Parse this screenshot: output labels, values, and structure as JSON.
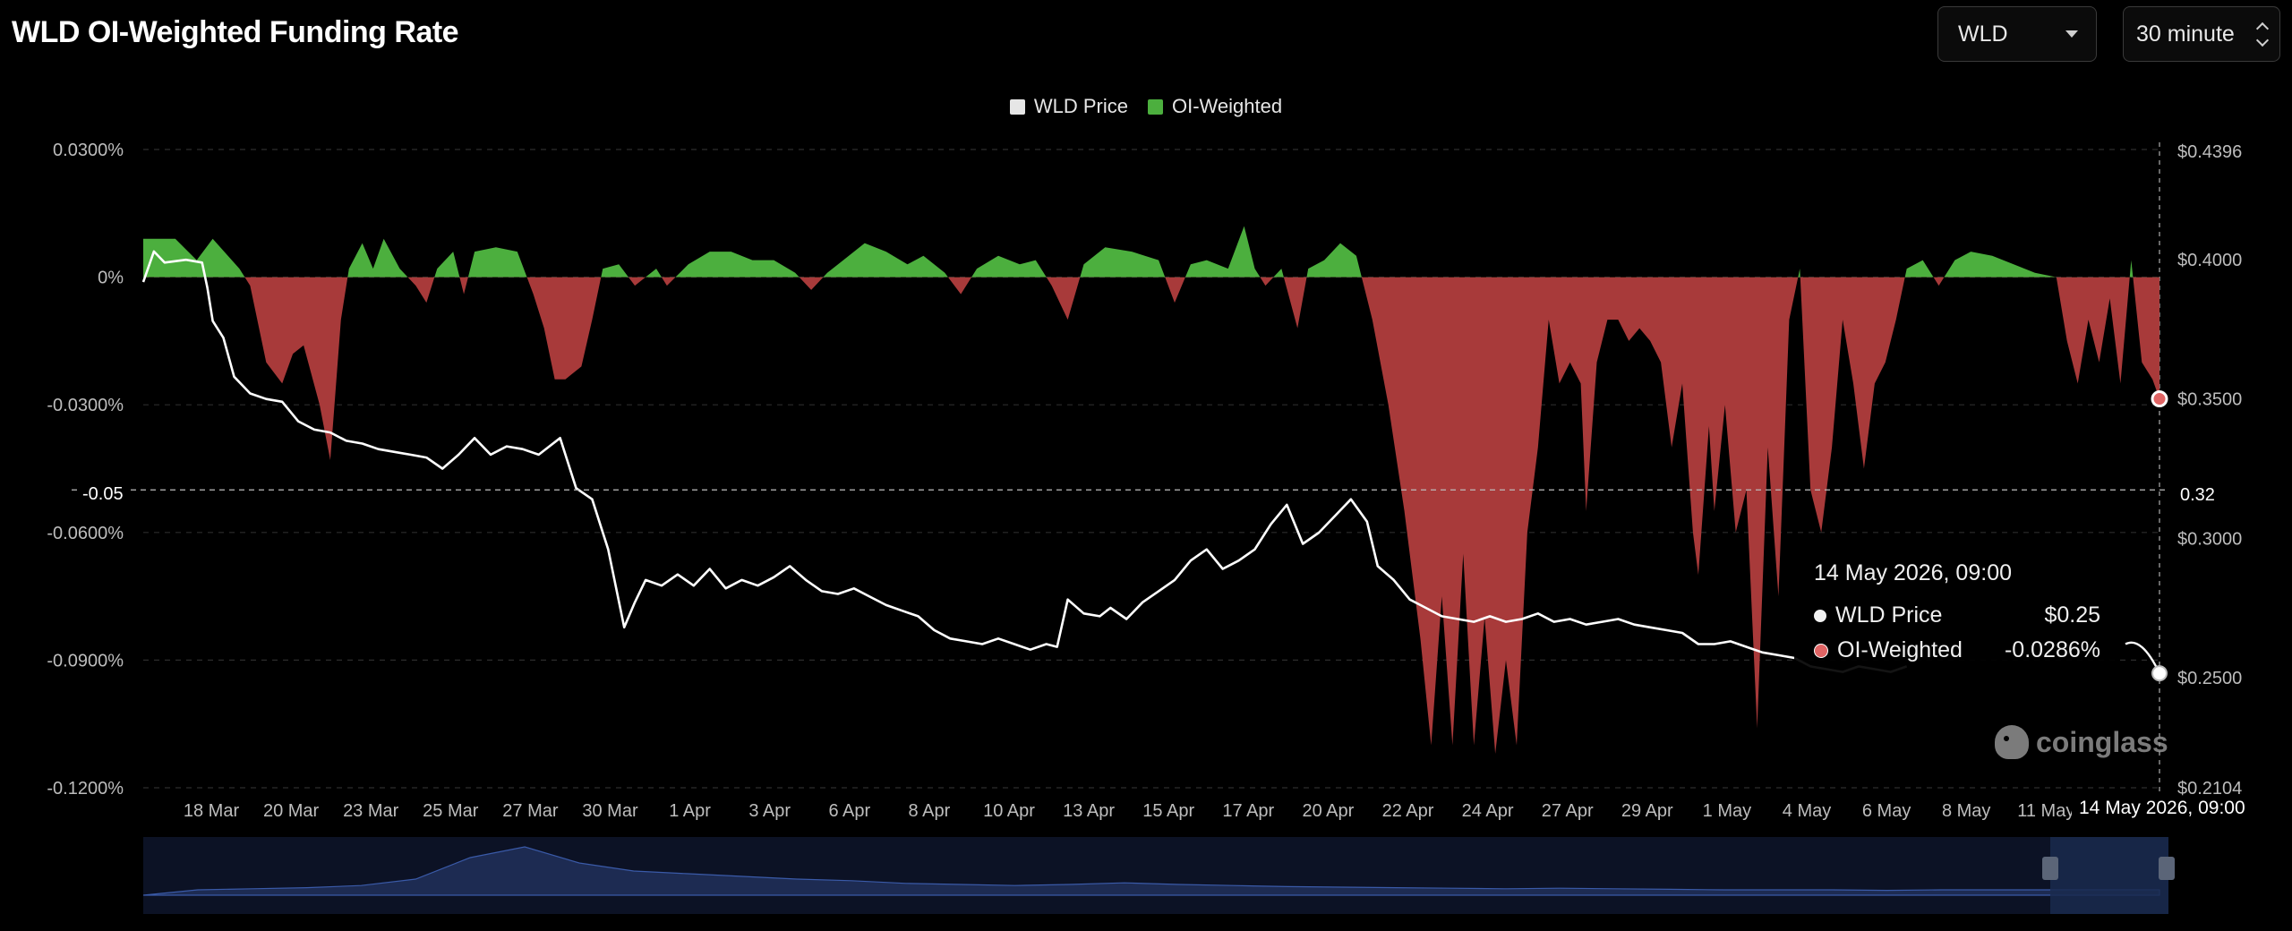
{
  "header": {
    "title": "WLD OI-Weighted Funding Rate",
    "coin_select": "WLD",
    "interval_select": "30 minute"
  },
  "legend": [
    {
      "label": "WLD Price",
      "color": "#e6e6e6"
    },
    {
      "label": "OI-Weighted",
      "color": "#4caf3e"
    }
  ],
  "tooltip": {
    "date": "14 May 2026, 09:00",
    "rows": [
      {
        "label": "WLD Price",
        "value": "$0.25",
        "color": "#f2f2f2"
      },
      {
        "label": "OI-Weighted",
        "value": "-0.0286%",
        "color": "#e06464"
      }
    ]
  },
  "crosshair": {
    "left_label": "-0.05",
    "right_label": "0.32",
    "date_label": "14 May 2026, 09:00"
  },
  "watermark": "coinglass",
  "colors": {
    "positive": "#4caf3e",
    "negative": "#a83a3a",
    "price": "#ffffff",
    "grid": "#2c2c2c",
    "navigator": "#1b2743"
  },
  "chart_data": {
    "type": "area",
    "x_type": "date",
    "x_ticks": [
      "18 Mar",
      "20 Mar",
      "23 Mar",
      "25 Mar",
      "27 Mar",
      "30 Mar",
      "1 Apr",
      "3 Apr",
      "6 Apr",
      "8 Apr",
      "10 Apr",
      "13 Apr",
      "15 Apr",
      "17 Apr",
      "20 Apr",
      "22 Apr",
      "24 Apr",
      "27 Apr",
      "29 Apr",
      "1 May",
      "4 May",
      "6 May",
      "8 May",
      "11 May"
    ],
    "y_left": {
      "ticks": [
        "0.0300%",
        "0%",
        "-0.0300%",
        "-0.0600%",
        "-0.0900%",
        "-0.1200%"
      ],
      "ylim": [
        -0.12,
        0.03
      ]
    },
    "y_right": {
      "ticks": [
        "$0.4396",
        "$0.4000",
        "$0.3500",
        "$0.3000",
        "$0.2500",
        "$0.2104"
      ],
      "ylim": [
        0.2104,
        0.4396
      ]
    },
    "series": [
      {
        "name": "OI-Weighted",
        "axis": "left",
        "unit": "%",
        "points": [
          [
            0,
            0.009
          ],
          [
            0.6,
            0.009
          ],
          [
            1.0,
            0.004
          ],
          [
            1.3,
            0.009
          ],
          [
            1.8,
            0.002
          ],
          [
            2.0,
            -0.002
          ],
          [
            2.3,
            -0.02
          ],
          [
            2.6,
            -0.025
          ],
          [
            2.8,
            -0.018
          ],
          [
            3.0,
            -0.016
          ],
          [
            3.3,
            -0.03
          ],
          [
            3.5,
            -0.043
          ],
          [
            3.7,
            -0.01
          ],
          [
            3.85,
            0.002
          ],
          [
            4.1,
            0.008
          ],
          [
            4.3,
            0.002
          ],
          [
            4.5,
            0.009
          ],
          [
            4.8,
            0.002
          ],
          [
            5.1,
            -0.002
          ],
          [
            5.3,
            -0.006
          ],
          [
            5.5,
            0.002
          ],
          [
            5.8,
            0.006
          ],
          [
            6.0,
            -0.004
          ],
          [
            6.2,
            0.006
          ],
          [
            6.6,
            0.007
          ],
          [
            7.0,
            0.006
          ],
          [
            7.3,
            -0.004
          ],
          [
            7.5,
            -0.012
          ],
          [
            7.7,
            -0.024
          ],
          [
            7.9,
            -0.024
          ],
          [
            8.2,
            -0.021
          ],
          [
            8.4,
            -0.01
          ],
          [
            8.6,
            0.002
          ],
          [
            8.9,
            0.003
          ],
          [
            9.2,
            -0.002
          ],
          [
            9.6,
            0.002
          ],
          [
            9.8,
            -0.002
          ],
          [
            10.2,
            0.003
          ],
          [
            10.6,
            0.006
          ],
          [
            11.0,
            0.006
          ],
          [
            11.4,
            0.004
          ],
          [
            11.8,
            0.004
          ],
          [
            12.2,
            0.001
          ],
          [
            12.5,
            -0.003
          ],
          [
            12.8,
            0.001
          ],
          [
            13.1,
            0.004
          ],
          [
            13.5,
            0.008
          ],
          [
            13.9,
            0.006
          ],
          [
            14.3,
            0.003
          ],
          [
            14.6,
            0.005
          ],
          [
            15.0,
            0.001
          ],
          [
            15.3,
            -0.004
          ],
          [
            15.6,
            0.002
          ],
          [
            16.0,
            0.005
          ],
          [
            16.4,
            0.003
          ],
          [
            16.7,
            0.004
          ],
          [
            17.0,
            -0.002
          ],
          [
            17.3,
            -0.01
          ],
          [
            17.6,
            0.003
          ],
          [
            18.0,
            0.007
          ],
          [
            18.5,
            0.006
          ],
          [
            19.0,
            0.004
          ],
          [
            19.3,
            -0.006
          ],
          [
            19.6,
            0.003
          ],
          [
            19.9,
            0.004
          ],
          [
            20.3,
            0.002
          ],
          [
            20.6,
            0.012
          ],
          [
            20.8,
            0.002
          ],
          [
            21.0,
            -0.002
          ],
          [
            21.3,
            0.002
          ],
          [
            21.6,
            -0.012
          ],
          [
            21.8,
            0.002
          ],
          [
            22.1,
            0.004
          ],
          [
            22.4,
            0.008
          ],
          [
            22.7,
            0.005
          ],
          [
            23.0,
            -0.01
          ],
          [
            23.3,
            -0.03
          ],
          [
            23.6,
            -0.055
          ],
          [
            23.9,
            -0.085
          ],
          [
            24.1,
            -0.11
          ],
          [
            24.3,
            -0.075
          ],
          [
            24.5,
            -0.11
          ],
          [
            24.7,
            -0.065
          ],
          [
            24.9,
            -0.11
          ],
          [
            25.1,
            -0.08
          ],
          [
            25.3,
            -0.112
          ],
          [
            25.5,
            -0.09
          ],
          [
            25.7,
            -0.11
          ],
          [
            25.9,
            -0.06
          ],
          [
            26.1,
            -0.04
          ],
          [
            26.3,
            -0.01
          ],
          [
            26.5,
            -0.025
          ],
          [
            26.7,
            -0.02
          ],
          [
            26.9,
            -0.025
          ],
          [
            27.0,
            -0.055
          ],
          [
            27.2,
            -0.02
          ],
          [
            27.4,
            -0.01
          ],
          [
            27.6,
            -0.01
          ],
          [
            27.8,
            -0.015
          ],
          [
            28.0,
            -0.012
          ],
          [
            28.2,
            -0.015
          ],
          [
            28.4,
            -0.02
          ],
          [
            28.6,
            -0.04
          ],
          [
            28.8,
            -0.025
          ],
          [
            29.0,
            -0.06
          ],
          [
            29.1,
            -0.07
          ],
          [
            29.3,
            -0.035
          ],
          [
            29.4,
            -0.055
          ],
          [
            29.6,
            -0.03
          ],
          [
            29.8,
            -0.06
          ],
          [
            30.0,
            -0.05
          ],
          [
            30.2,
            -0.106
          ],
          [
            30.4,
            -0.04
          ],
          [
            30.6,
            -0.075
          ],
          [
            30.8,
            -0.01
          ],
          [
            31.0,
            0.002
          ],
          [
            31.2,
            -0.05
          ],
          [
            31.4,
            -0.06
          ],
          [
            31.6,
            -0.04
          ],
          [
            31.8,
            -0.01
          ],
          [
            32.0,
            -0.025
          ],
          [
            32.2,
            -0.045
          ],
          [
            32.4,
            -0.025
          ],
          [
            32.6,
            -0.02
          ],
          [
            32.8,
            -0.01
          ],
          [
            33.0,
            0.002
          ],
          [
            33.3,
            0.004
          ],
          [
            33.6,
            -0.002
          ],
          [
            33.9,
            0.004
          ],
          [
            34.2,
            0.006
          ],
          [
            34.6,
            0.005
          ],
          [
            35.0,
            0.003
          ],
          [
            35.4,
            0.001
          ],
          [
            35.8,
            0.0
          ],
          [
            36.0,
            -0.015
          ],
          [
            36.2,
            -0.025
          ],
          [
            36.4,
            -0.01
          ],
          [
            36.6,
            -0.02
          ],
          [
            36.8,
            -0.005
          ],
          [
            37.0,
            -0.025
          ],
          [
            37.2,
            0.004
          ],
          [
            37.4,
            -0.02
          ],
          [
            37.6,
            -0.024
          ],
          [
            37.73,
            -0.0286
          ]
        ]
      },
      {
        "name": "WLD Price",
        "axis": "right",
        "unit": "$",
        "points": [
          [
            0,
            0.392
          ],
          [
            0.2,
            0.403
          ],
          [
            0.4,
            0.399
          ],
          [
            0.8,
            0.4
          ],
          [
            1.1,
            0.399
          ],
          [
            1.2,
            0.39
          ],
          [
            1.3,
            0.378
          ],
          [
            1.5,
            0.372
          ],
          [
            1.7,
            0.358
          ],
          [
            2.0,
            0.352
          ],
          [
            2.3,
            0.35
          ],
          [
            2.6,
            0.349
          ],
          [
            2.9,
            0.342
          ],
          [
            3.2,
            0.339
          ],
          [
            3.5,
            0.338
          ],
          [
            3.8,
            0.335
          ],
          [
            4.1,
            0.334
          ],
          [
            4.4,
            0.332
          ],
          [
            4.7,
            0.331
          ],
          [
            5.0,
            0.33
          ],
          [
            5.3,
            0.329
          ],
          [
            5.6,
            0.325
          ],
          [
            5.9,
            0.33
          ],
          [
            6.2,
            0.336
          ],
          [
            6.5,
            0.33
          ],
          [
            6.8,
            0.333
          ],
          [
            7.1,
            0.332
          ],
          [
            7.4,
            0.33
          ],
          [
            7.8,
            0.336
          ],
          [
            8.1,
            0.318
          ],
          [
            8.4,
            0.314
          ],
          [
            8.7,
            0.296
          ],
          [
            9.0,
            0.268
          ],
          [
            9.2,
            0.277
          ],
          [
            9.4,
            0.285
          ],
          [
            9.7,
            0.283
          ],
          [
            10.0,
            0.287
          ],
          [
            10.3,
            0.283
          ],
          [
            10.6,
            0.289
          ],
          [
            10.9,
            0.282
          ],
          [
            11.2,
            0.285
          ],
          [
            11.5,
            0.283
          ],
          [
            11.8,
            0.286
          ],
          [
            12.1,
            0.29
          ],
          [
            12.4,
            0.285
          ],
          [
            12.7,
            0.281
          ],
          [
            13.0,
            0.28
          ],
          [
            13.3,
            0.282
          ],
          [
            13.6,
            0.279
          ],
          [
            13.9,
            0.276
          ],
          [
            14.2,
            0.274
          ],
          [
            14.5,
            0.272
          ],
          [
            14.8,
            0.267
          ],
          [
            15.1,
            0.264
          ],
          [
            15.4,
            0.263
          ],
          [
            15.7,
            0.262
          ],
          [
            16.0,
            0.264
          ],
          [
            16.3,
            0.262
          ],
          [
            16.6,
            0.26
          ],
          [
            16.9,
            0.262
          ],
          [
            17.1,
            0.261
          ],
          [
            17.3,
            0.278
          ],
          [
            17.6,
            0.273
          ],
          [
            17.9,
            0.272
          ],
          [
            18.1,
            0.275
          ],
          [
            18.4,
            0.271
          ],
          [
            18.7,
            0.277
          ],
          [
            19.0,
            0.281
          ],
          [
            19.3,
            0.285
          ],
          [
            19.6,
            0.292
          ],
          [
            19.9,
            0.296
          ],
          [
            20.2,
            0.289
          ],
          [
            20.5,
            0.292
          ],
          [
            20.8,
            0.296
          ],
          [
            21.1,
            0.305
          ],
          [
            21.4,
            0.312
          ],
          [
            21.7,
            0.298
          ],
          [
            22.0,
            0.302
          ],
          [
            22.3,
            0.308
          ],
          [
            22.6,
            0.314
          ],
          [
            22.9,
            0.306
          ],
          [
            23.1,
            0.29
          ],
          [
            23.4,
            0.285
          ],
          [
            23.7,
            0.278
          ],
          [
            24.0,
            0.275
          ],
          [
            24.3,
            0.272
          ],
          [
            24.6,
            0.271
          ],
          [
            24.9,
            0.27
          ],
          [
            25.2,
            0.272
          ],
          [
            25.5,
            0.27
          ],
          [
            25.8,
            0.271
          ],
          [
            26.1,
            0.273
          ],
          [
            26.4,
            0.27
          ],
          [
            26.7,
            0.271
          ],
          [
            27.0,
            0.269
          ],
          [
            27.3,
            0.27
          ],
          [
            27.6,
            0.271
          ],
          [
            27.9,
            0.269
          ],
          [
            28.2,
            0.268
          ],
          [
            28.5,
            0.267
          ],
          [
            28.8,
            0.266
          ],
          [
            29.1,
            0.262
          ],
          [
            29.4,
            0.262
          ],
          [
            29.7,
            0.263
          ],
          [
            30.0,
            0.261
          ],
          [
            30.3,
            0.259
          ],
          [
            30.6,
            0.258
          ],
          [
            30.9,
            0.257
          ],
          [
            31.2,
            0.254
          ],
          [
            31.5,
            0.253
          ],
          [
            31.8,
            0.252
          ],
          [
            32.1,
            0.254
          ],
          [
            32.4,
            0.253
          ],
          [
            32.7,
            0.252
          ],
          [
            33.0,
            0.254
          ]
        ]
      }
    ],
    "grid": true,
    "legend_position": "top-center"
  }
}
